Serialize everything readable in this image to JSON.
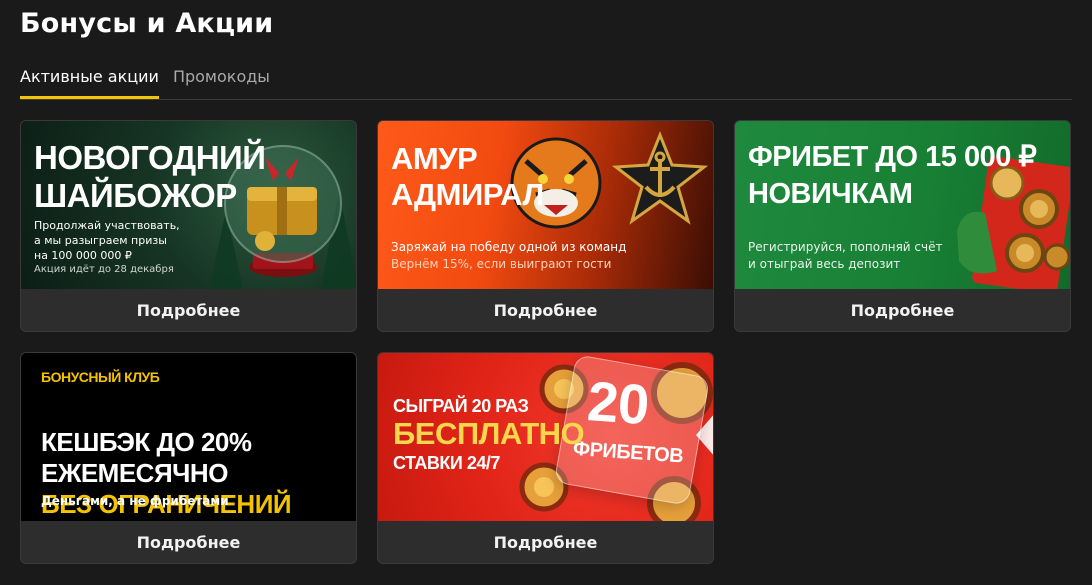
{
  "header": {
    "title": "Бонусы и Акции"
  },
  "tabs": [
    {
      "label": "Активные акции",
      "active": true
    },
    {
      "label": "Промокоды",
      "active": false
    }
  ],
  "colors": {
    "accent": "#f4c300",
    "background": "#1a1a1a",
    "card": "#2d2d2d"
  },
  "cards": [
    {
      "headline": [
        "Новогодний",
        "шайбожор"
      ],
      "subtext": [
        "Продолжай участвовать,",
        "а мы разыграем призы",
        "на 100 000 000 ₽"
      ],
      "note": "Акция идёт до 28 декабря",
      "button": "Подробнее"
    },
    {
      "headline": [
        "Амур",
        "Адмирал"
      ],
      "subtext": [
        "Заряжай на победу одной из команд",
        "Вернём 15%, если выиграют гости"
      ],
      "button": "Подробнее"
    },
    {
      "headline": [
        "Фрибет до 15 000 ₽",
        "новичкам"
      ],
      "subtext": [
        "Регистрируйся, пополняй счёт",
        "и отыграй весь депозит"
      ],
      "button": "Подробнее"
    },
    {
      "label": "Бонусный клуб",
      "headline": [
        "Кешбэк до 20% ежемесячно",
        "без ограничений"
      ],
      "subtext": [
        "Деньгами, а не фрибетами"
      ],
      "button": "Подробнее"
    },
    {
      "headline": [
        "Сыграй 20 раз",
        "бесплатно",
        "ставки 24/7"
      ],
      "badge_number": "20",
      "badge_text": "фрибетов",
      "button": "Подробнее"
    }
  ]
}
